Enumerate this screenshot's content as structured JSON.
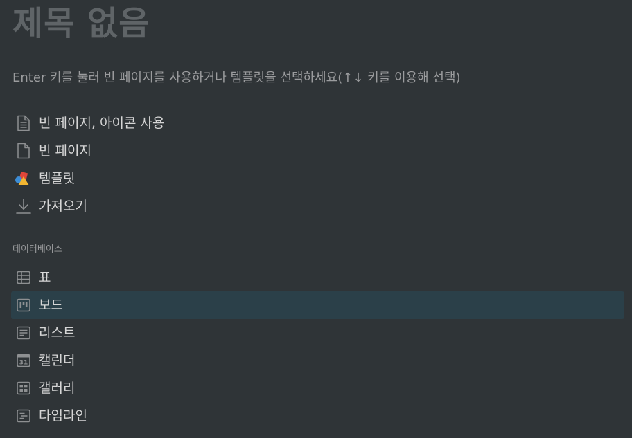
{
  "page": {
    "title": "제목 없음",
    "hint": "Enter 키를 눌러 빈 페이지를 사용하거나 템플릿을 선택하세요(↑↓ 키를 이용해 선택)"
  },
  "top_items": [
    {
      "label": "빈 페이지, 아이콘 사용",
      "icon": "document-icon"
    },
    {
      "label": "빈 페이지",
      "icon": "blank-page-icon"
    },
    {
      "label": "템플릿",
      "icon": "shapes-icon"
    },
    {
      "label": "가져오기",
      "icon": "download-icon"
    }
  ],
  "database": {
    "section_label": "데이터베이스",
    "items": [
      {
        "label": "표",
        "icon": "table-icon"
      },
      {
        "label": "보드",
        "icon": "board-icon",
        "selected": true
      },
      {
        "label": "리스트",
        "icon": "list-icon"
      },
      {
        "label": "캘린더",
        "icon": "calendar-icon",
        "icon_text": "31"
      },
      {
        "label": "갤러리",
        "icon": "gallery-icon"
      },
      {
        "label": "타임라인",
        "icon": "timeline-icon"
      }
    ]
  },
  "colors": {
    "background": "#2f3437",
    "selected_row": "#2b4049",
    "title": "#5f6467",
    "muted_text": "#9b9c9e",
    "icon": "#8e9092"
  }
}
